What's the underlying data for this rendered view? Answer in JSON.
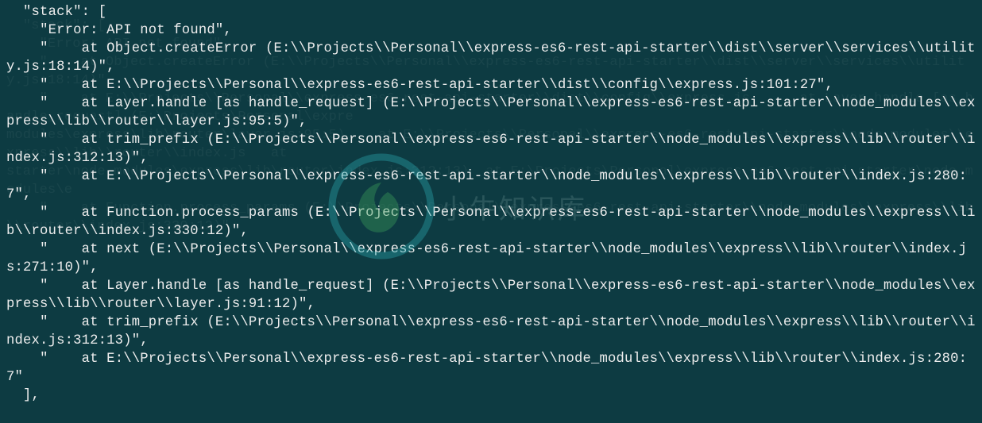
{
  "key_label": "\"stack\"",
  "stack": [
    "Error: API not found",
    "    at Object.createError (E:\\\\Projects\\\\Personal\\\\express-es6-rest-api-starter\\\\dist\\\\server\\\\services\\\\utility.js:18:14)",
    "    at E:\\\\Projects\\\\Personal\\\\express-es6-rest-api-starter\\\\dist\\\\config\\\\express.js:101:27",
    "    at Layer.handle [as handle_request] (E:\\\\Projects\\\\Personal\\\\express-es6-rest-api-starter\\\\node_modules\\\\express\\\\lib\\\\router\\\\layer.js:95:5)",
    "    at trim_prefix (E:\\\\Projects\\\\Personal\\\\express-es6-rest-api-starter\\\\node_modules\\\\express\\\\lib\\\\router\\\\index.js:312:13)",
    "    at E:\\\\Projects\\\\Personal\\\\express-es6-rest-api-starter\\\\node_modules\\\\express\\\\lib\\\\router\\\\index.js:280:7",
    "    at Function.process_params (E:\\\\Projects\\\\Personal\\\\express-es6-rest-api-starter\\\\node_modules\\\\express\\\\lib\\\\router\\\\index.js:330:12)",
    "    at next (E:\\\\Projects\\\\Personal\\\\express-es6-rest-api-starter\\\\node_modules\\\\express\\\\lib\\\\router\\\\index.js:271:10)",
    "    at Layer.handle [as handle_request] (E:\\\\Projects\\\\Personal\\\\express-es6-rest-api-starter\\\\node_modules\\\\express\\\\lib\\\\router\\\\layer.js:91:12)",
    "    at trim_prefix (E:\\\\Projects\\\\Personal\\\\express-es6-rest-api-starter\\\\node_modules\\\\express\\\\lib\\\\router\\\\index.js:312:13)",
    "    at E:\\\\Projects\\\\Personal\\\\express-es6-rest-api-starter\\\\node_modules\\\\express\\\\lib\\\\router\\\\index.js:280:7"
  ],
  "watermark_text": "小牛知识库",
  "colors": {
    "bg": "#0d3b42",
    "fg": "#ededed",
    "wm_ring": "#2aa8b0",
    "wm_fill": "#3a9b5a"
  }
}
